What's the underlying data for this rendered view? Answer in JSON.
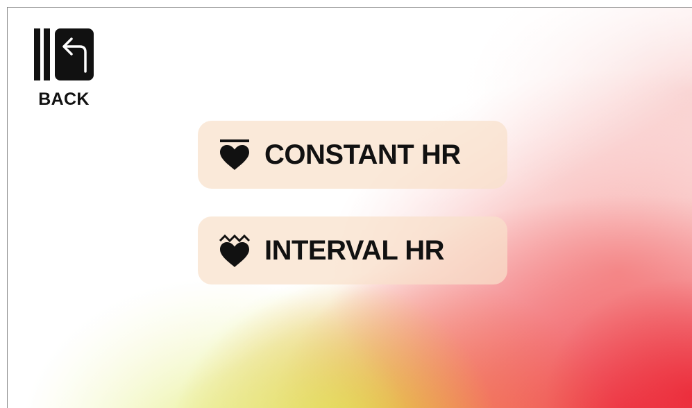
{
  "back": {
    "label": "BACK",
    "icon": "back-arrow-icon"
  },
  "menu": [
    {
      "label": "CONSTANT HR",
      "icon": "constant-hr-heart-icon"
    },
    {
      "label": "INTERVAL HR",
      "icon": "interval-hr-heart-icon"
    }
  ],
  "colors": {
    "button_bg": "#f8e0ca",
    "text": "#111111",
    "gradient_red": "#e8213a",
    "gradient_orange": "#f07030",
    "gradient_yellow": "#dee946"
  }
}
